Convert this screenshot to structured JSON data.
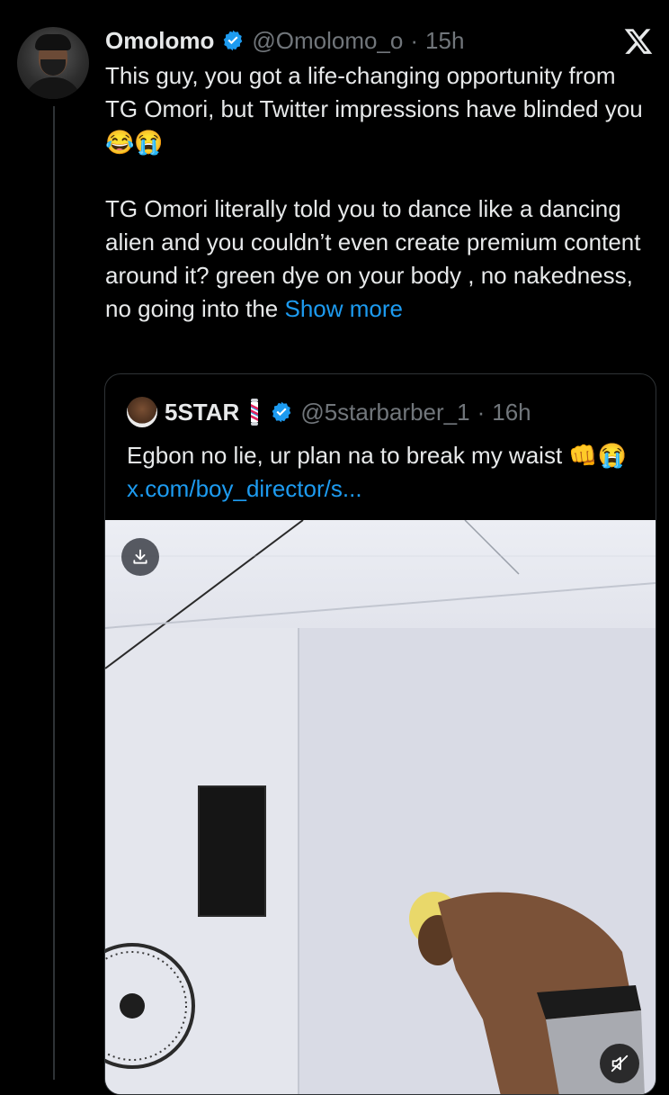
{
  "tweet": {
    "author_name": "Omolomo",
    "author_handle": "@Omolomo_o",
    "separator": "·",
    "time": "15h",
    "text_line1": "This guy, you got a life-changing opportunity from TG Omori, but Twitter impressions have blinded you 😂😭",
    "text_para2": "TG Omori literally told you to dance like a dancing alien and you couldn’t even create premium content around it? green dye on your body , no nakedness, no going into the ",
    "show_more": "Show more"
  },
  "quote": {
    "author_name": "5STAR",
    "author_handle": "@5starbarber_1",
    "separator": "·",
    "time": "16h",
    "text": "Egbon no lie, ur plan na to break my waist ",
    "emojis": "👊😭",
    "link": "x.com/boy_director/s..."
  },
  "icons": {
    "verified": "verified-badge-icon",
    "platform": "x-logo-icon",
    "download": "download-icon",
    "mute": "volume-muted-icon"
  },
  "colors": {
    "background": "#000000",
    "accent": "#1d9bf0",
    "secondary_text": "#71767b"
  }
}
